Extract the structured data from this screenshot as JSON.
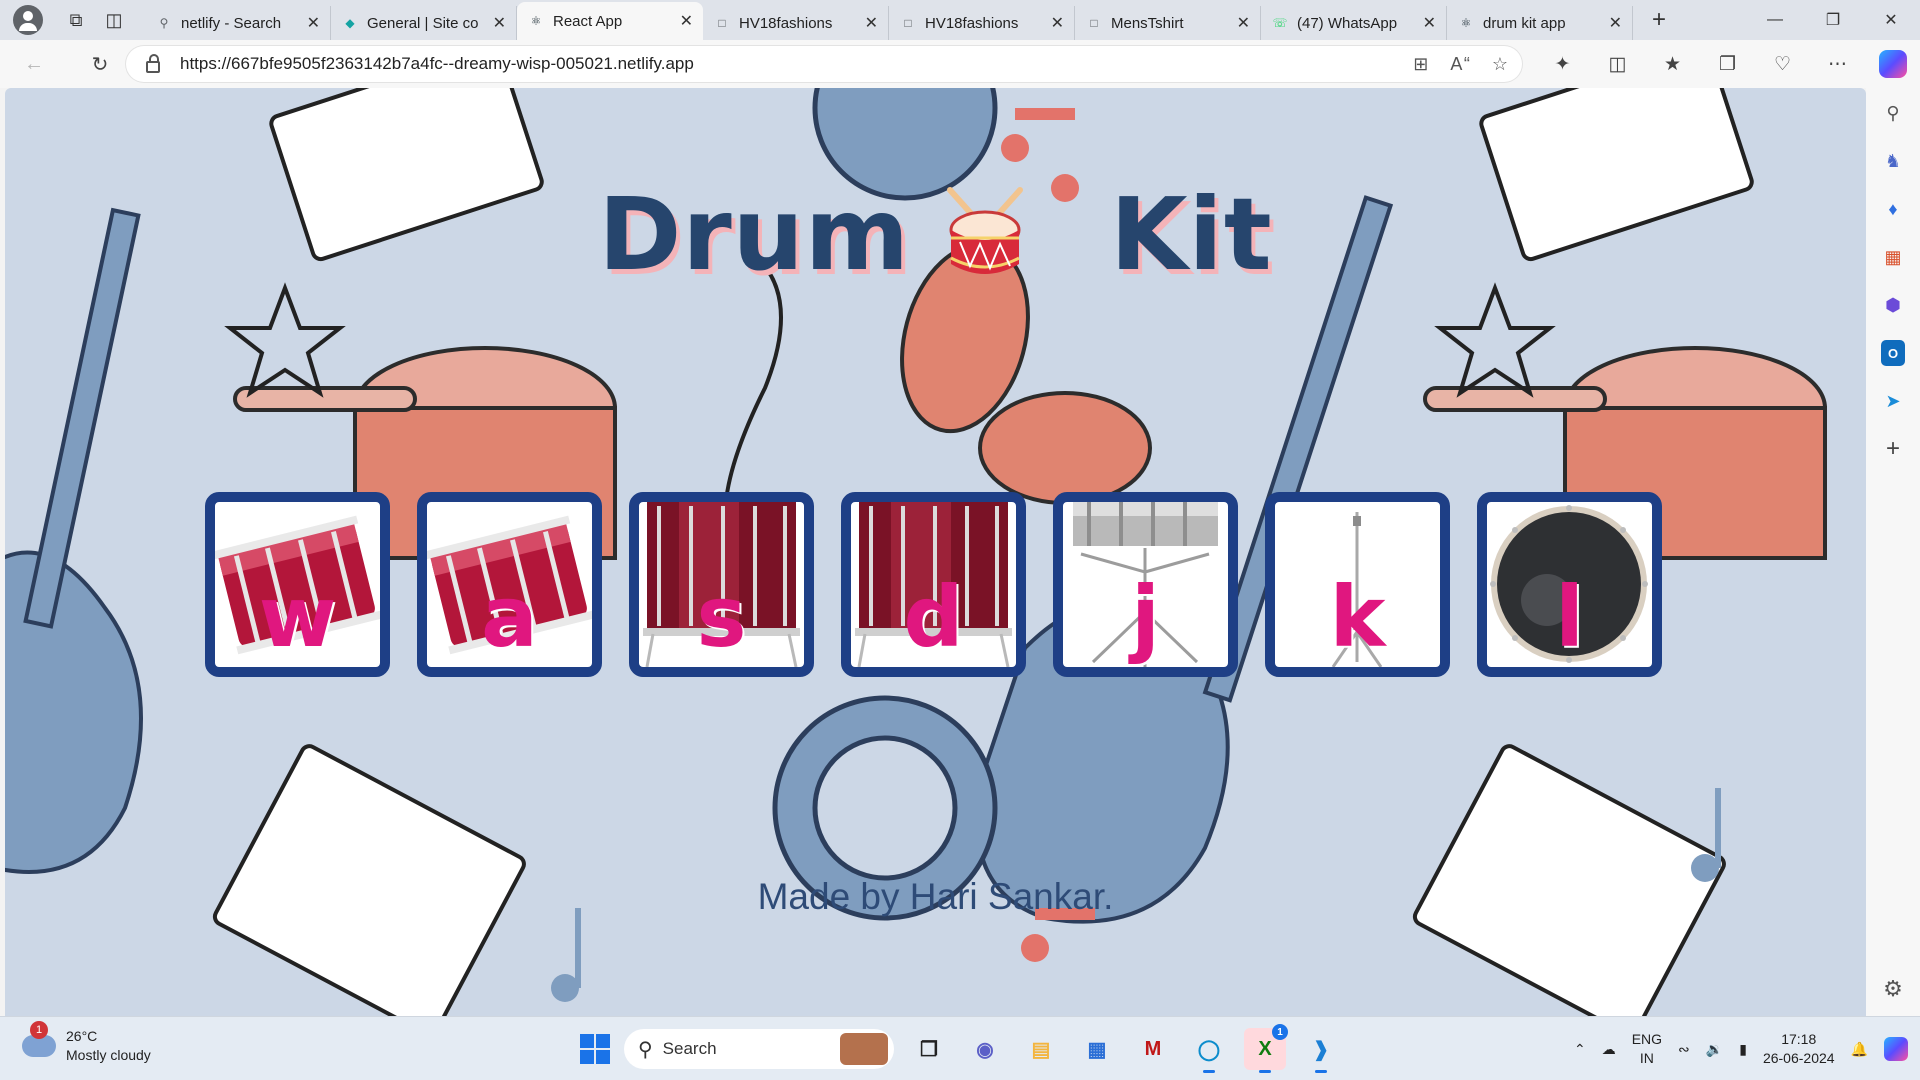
{
  "browser": {
    "tabs": [
      {
        "title": "netlify - Search",
        "favicon": "search-icon",
        "color": "#5f6368"
      },
      {
        "title": "General | Site co",
        "favicon": "netlify-icon",
        "color": "#14a3a3"
      },
      {
        "title": "React App",
        "favicon": "react-icon",
        "color": "#1b2b34",
        "active": true
      },
      {
        "title": "HV18fashions",
        "favicon": "page-icon",
        "color": "#5f6368"
      },
      {
        "title": "HV18fashions",
        "favicon": "page-icon",
        "color": "#5f6368"
      },
      {
        "title": "MensTshirt",
        "favicon": "page-icon",
        "color": "#5f6368"
      },
      {
        "title": "(47) WhatsApp",
        "favicon": "whatsapp-icon",
        "color": "#25d366"
      },
      {
        "title": "drum kit app",
        "favicon": "react-icon",
        "color": "#1b2b34"
      }
    ],
    "url": "https://667bfe9505f2363142b7a4fc--dreamy-wisp-005021.netlify.app"
  },
  "app": {
    "title_left": "Drum",
    "title_right": "Kit",
    "title_emoji": "drum-icon",
    "keys": [
      {
        "letter": "w",
        "image": "red-tom-drum"
      },
      {
        "letter": "a",
        "image": "red-tom-drum"
      },
      {
        "letter": "s",
        "image": "dark-red-floor-tom"
      },
      {
        "letter": "d",
        "image": "dark-red-floor-tom"
      },
      {
        "letter": "j",
        "image": "silver-snare-drum"
      },
      {
        "letter": "k",
        "image": "cymbal-stand"
      },
      {
        "letter": "l",
        "image": "bass-drum-head"
      }
    ],
    "footer": "Made by Hari Sankar.",
    "colors": {
      "title": "#26456d",
      "title_shadow": "#f4b3b8",
      "key_border": "#1e3f86",
      "letter": "#e0177f",
      "background": "#ccd7e6"
    }
  },
  "taskbar": {
    "weather": {
      "temp": "26°C",
      "condition": "Mostly cloudy",
      "badge": "1"
    },
    "search_placeholder": "Search",
    "xbox_badge": "1",
    "lang_line1": "ENG",
    "lang_line2": "IN",
    "time": "17:18",
    "date": "26-06-2024"
  }
}
